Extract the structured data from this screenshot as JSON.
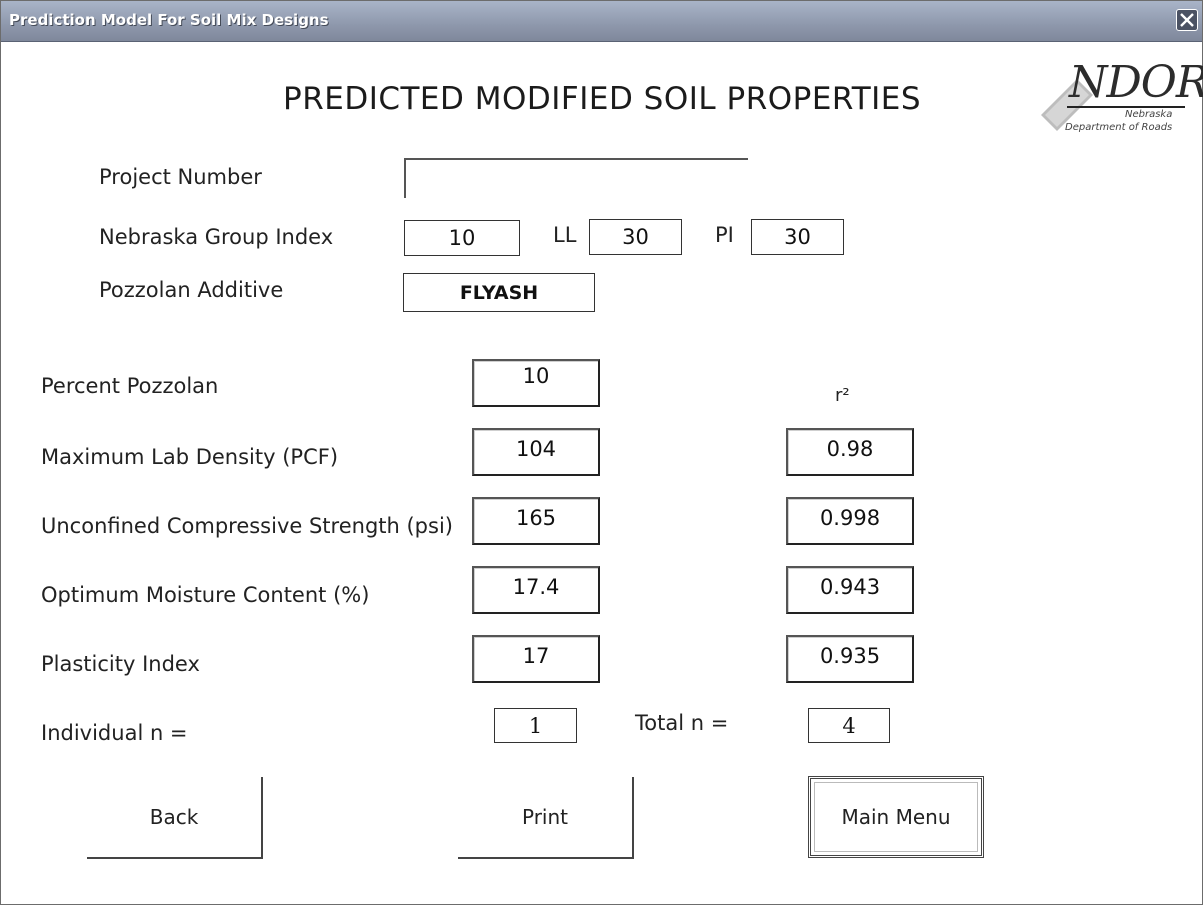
{
  "window": {
    "title": "Prediction Model For Soil Mix Designs"
  },
  "header": {
    "title": "PREDICTED MODIFIED SOIL PROPERTIES",
    "logo": {
      "main": "NDOR",
      "line1": "Nebraska",
      "line2": "Department of Roads"
    }
  },
  "inputs": {
    "project_number_label": "Project Number",
    "project_number_value": "",
    "group_index_label": "Nebraska Group Index",
    "group_index_value": "10",
    "ll_label": "LL",
    "ll_value": "30",
    "pi_label": "PI",
    "pi_value": "30",
    "pozzolan_additive_label": "Pozzolan Additive",
    "pozzolan_additive_value": "FLYASH"
  },
  "results": {
    "r2_header": "r²",
    "percent_pozzolan": {
      "label": "Percent Pozzolan",
      "value": "10"
    },
    "rows": [
      {
        "label": "Maximum Lab Density (PCF)",
        "value": "104",
        "r2": "0.98"
      },
      {
        "label": "Unconfined Compressive Strength (psi)",
        "value": "165",
        "r2": "0.998"
      },
      {
        "label": "Optimum Moisture Content (%)",
        "value": "17.4",
        "r2": "0.943"
      },
      {
        "label": "Plasticity Index",
        "value": "17",
        "r2": "0.935"
      }
    ],
    "individual_n_label": "Individual n =",
    "individual_n_value": "1",
    "total_n_label": "Total n =",
    "total_n_value": "4"
  },
  "buttons": {
    "back": "Back",
    "print": "Print",
    "main_menu": "Main Menu"
  }
}
